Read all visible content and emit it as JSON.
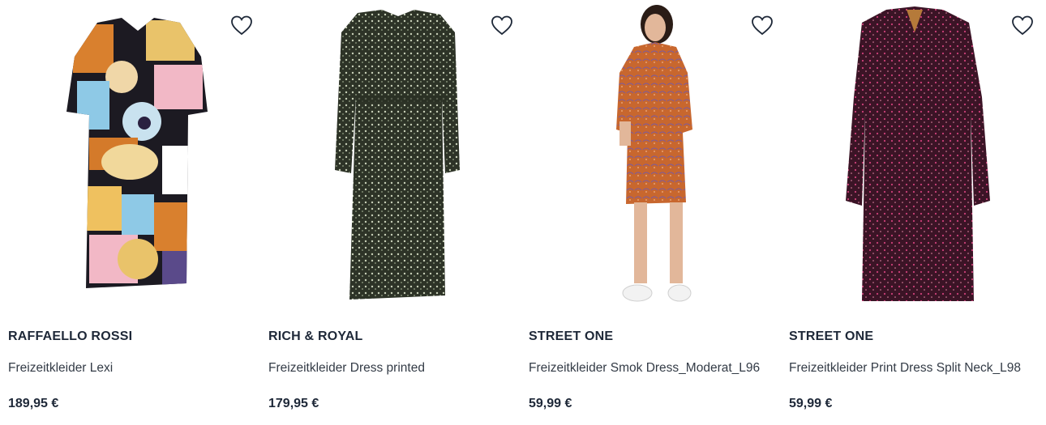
{
  "products": [
    {
      "brand": "RAFFAELLO ROSSI",
      "name": "Freizeitkleider Lexi",
      "price": "189,95 €",
      "wishlist_icon": "heart-outline-icon",
      "image": "multicolor geometric print dress"
    },
    {
      "brand": "RICH & ROYAL",
      "name": "Freizeitkleider Dress printed",
      "price": "179,95 €",
      "wishlist_icon": "heart-outline-icon",
      "image": "dark green floral long-sleeve dress"
    },
    {
      "brand": "STREET ONE",
      "name": "Freizeitkleider Smok Dress_Moderat_L96",
      "price": "59,99 €",
      "wishlist_icon": "heart-outline-icon",
      "image": "orange paisley dress on model"
    },
    {
      "brand": "STREET ONE",
      "name": "Freizeitkleider Print Dress Split Neck_L98",
      "price": "59,99 €",
      "wishlist_icon": "heart-outline-icon",
      "image": "burgundy pink speckled dress"
    }
  ],
  "colors": {
    "text_dark": "#1e2838",
    "text_body": "#333b46",
    "background": "#ffffff"
  }
}
